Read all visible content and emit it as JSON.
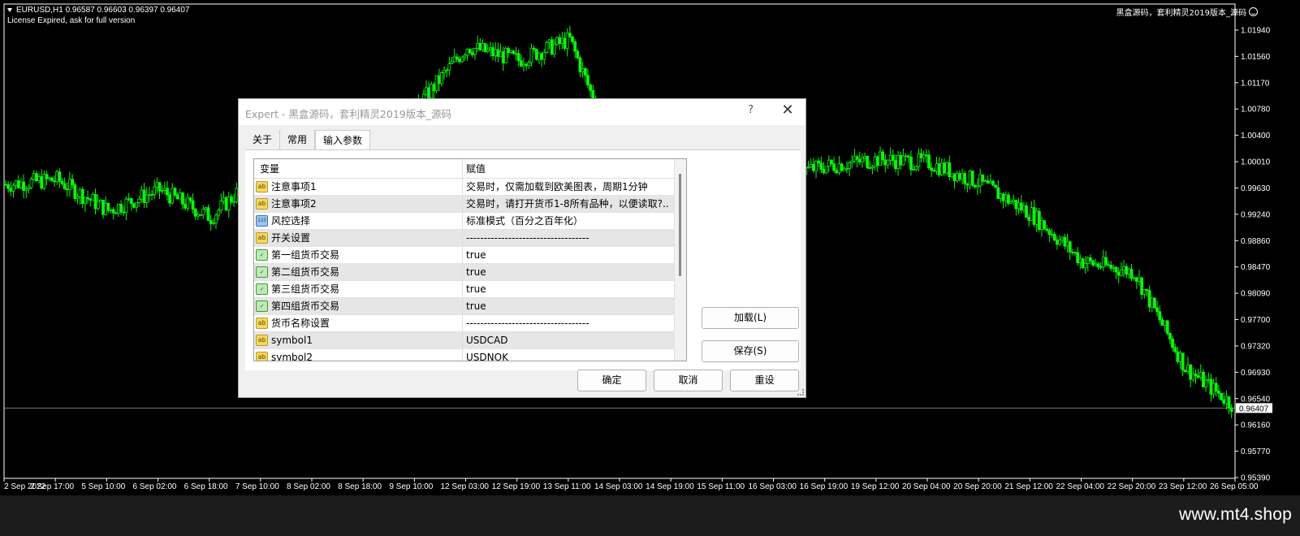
{
  "chart": {
    "symbol_line": "EURUSD,H1  0.96587 0.96603 0.96397 0.96407",
    "license_text": "License Expired, ask for full version",
    "ea_label": "黑盒源码，套利精灵2019版本_源码",
    "current_price": "0.96407",
    "price_labels": [
      "1.01940",
      "1.01560",
      "1.01170",
      "1.00780",
      "1.00400",
      "1.00010",
      "0.99630",
      "0.99240",
      "0.98860",
      "0.98470",
      "0.98090",
      "0.97700",
      "0.97320",
      "0.96930",
      "0.96540",
      "0.96160",
      "0.95770",
      "0.95390"
    ],
    "time_labels": [
      "2 Sep 2022",
      "2 Sep 17:00",
      "5 Sep 10:00",
      "6 Sep 02:00",
      "6 Sep 18:00",
      "7 Sep 10:00",
      "8 Sep 02:00",
      "8 Sep 18:00",
      "9 Sep 10:00",
      "12 Sep 03:00",
      "12 Sep 19:00",
      "13 Sep 11:00",
      "14 Sep 03:00",
      "14 Sep 19:00",
      "15 Sep 11:00",
      "16 Sep 03:00",
      "16 Sep 19:00",
      "19 Sep 12:00",
      "20 Sep 04:00",
      "20 Sep 20:00",
      "21 Sep 12:00",
      "22 Sep 04:00",
      "22 Sep 20:00",
      "23 Sep 12:00",
      "26 Sep 05:00"
    ],
    "candle_color": "#00ff00",
    "background": "#000000"
  },
  "chart_data": {
    "type": "line",
    "title": "",
    "xlabel": "",
    "ylabel": "",
    "ylim": [
      0.9539,
      1.0194
    ],
    "x": [
      "2 Sep 2022",
      "2 Sep 17:00",
      "5 Sep 10:00",
      "6 Sep 02:00",
      "6 Sep 18:00",
      "7 Sep 10:00",
      "8 Sep 02:00",
      "8 Sep 18:00",
      "9 Sep 10:00",
      "12 Sep 03:00",
      "12 Sep 19:00",
      "13 Sep 11:00",
      "14 Sep 03:00",
      "14 Sep 19:00",
      "15 Sep 11:00",
      "16 Sep 03:00",
      "16 Sep 19:00",
      "19 Sep 12:00",
      "20 Sep 04:00",
      "20 Sep 20:00",
      "21 Sep 12:00",
      "22 Sep 04:00",
      "22 Sep 20:00",
      "23 Sep 12:00",
      "26 Sep 05:00"
    ],
    "series": [
      {
        "values": [
          0.9968,
          0.9975,
          0.993,
          0.996,
          0.992,
          0.999,
          1.002,
          1.006,
          1.008,
          1.017,
          1.015,
          1.018,
          0.999,
          0.9995,
          0.999,
          0.998,
          0.9995,
          1.0005,
          1.0,
          0.997,
          0.9925,
          0.9855,
          0.984,
          0.97,
          0.9641
        ]
      }
    ]
  },
  "dialog": {
    "title": "Expert - 黑盒源码，套利精灵2019版本_源码",
    "help": "?",
    "tabs": [
      "关于",
      "常用",
      "输入参数"
    ],
    "columns": {
      "variable": "变量",
      "value": "赋值"
    },
    "rows": [
      {
        "icon": "ab",
        "type": "string",
        "name": "注意事项1",
        "value": "交易时，仅需加载到欧美图表，周期1分钟"
      },
      {
        "icon": "ab",
        "type": "string",
        "name": "注意事项2",
        "value": "交易时，请打开货币1-8所有品种，以便读取?.."
      },
      {
        "icon": "123",
        "type": "number",
        "name": "风控选择",
        "value": "标准模式（百分之百年化）"
      },
      {
        "icon": "ab",
        "type": "string",
        "name": "开关设置",
        "value": "-----------------------------------"
      },
      {
        "icon": "✓",
        "type": "bool",
        "name": "第一组货币交易",
        "value": "true"
      },
      {
        "icon": "✓",
        "type": "bool",
        "name": "第二组货币交易",
        "value": "true"
      },
      {
        "icon": "✓",
        "type": "bool",
        "name": "第三组货币交易",
        "value": "true"
      },
      {
        "icon": "✓",
        "type": "bool",
        "name": "第四组货币交易",
        "value": "true"
      },
      {
        "icon": "ab",
        "type": "string",
        "name": "货币名称设置",
        "value": "-----------------------------------"
      },
      {
        "icon": "ab",
        "type": "string",
        "name": "symbol1",
        "value": "USDCAD"
      },
      {
        "icon": "ab",
        "type": "string",
        "name": "symbol2",
        "value": "USDNOK"
      }
    ],
    "buttons": {
      "load": "加载(L)",
      "save": "保存(S)",
      "ok": "确定",
      "cancel": "取消",
      "reset": "重设"
    }
  },
  "brand": "www.mt4.shop"
}
